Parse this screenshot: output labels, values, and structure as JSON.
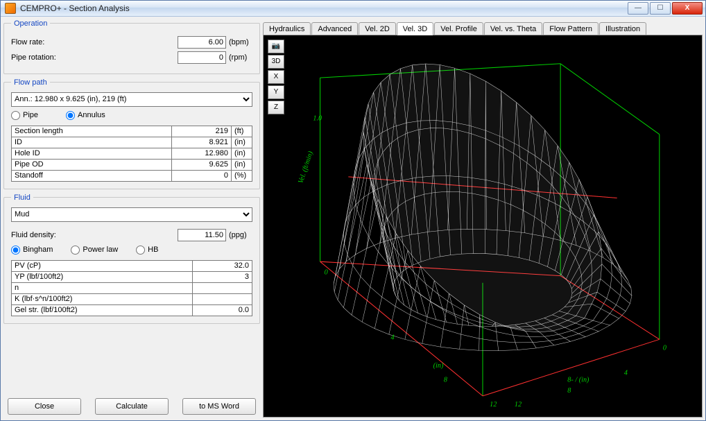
{
  "window": {
    "title": "CEMPRO+  -  Section Analysis"
  },
  "titlebar_buttons": {
    "min": "—",
    "max": "☐",
    "close": "X"
  },
  "operation": {
    "legend": "Operation",
    "flow_rate_label": "Flow rate:",
    "flow_rate_value": "6.00",
    "flow_rate_unit": "(bpm)",
    "pipe_rotation_label": "Pipe rotation:",
    "pipe_rotation_value": "0",
    "pipe_rotation_unit": "(rpm)"
  },
  "flowpath": {
    "legend": "Flow path",
    "combo_value": "Ann.: 12.980 x 9.625 (in), 219 (ft)",
    "radio_pipe": "Pipe",
    "radio_annulus": "Annulus",
    "radio_selected": "annulus",
    "rows": [
      {
        "label": "Section length",
        "value": "219",
        "unit": "(ft)"
      },
      {
        "label": "ID",
        "value": "8.921",
        "unit": "(in)"
      },
      {
        "label": "Hole ID",
        "value": "12.980",
        "unit": "(in)"
      },
      {
        "label": "Pipe OD",
        "value": "9.625",
        "unit": "(in)"
      },
      {
        "label": "Standoff",
        "value": "0",
        "unit": "(%)"
      }
    ]
  },
  "fluid": {
    "legend": "Fluid",
    "combo_value": "Mud",
    "density_label": "Fluid density:",
    "density_value": "11.50",
    "density_unit": "(ppg)",
    "radio_bingham": "Bingham",
    "radio_powerlaw": "Power law",
    "radio_hb": "HB",
    "radio_selected": "bingham",
    "rows": [
      {
        "label": "PV (cP)",
        "value": "32.0"
      },
      {
        "label": "YP (lbf/100ft2)",
        "value": "3"
      },
      {
        "label": "n",
        "value": ""
      },
      {
        "label": "K (lbf·s^n/100ft2)",
        "value": ""
      },
      {
        "label": "Gel str. (lbf/100ft2)",
        "value": "0.0"
      }
    ]
  },
  "buttons": {
    "close": "Close",
    "calculate": "Calculate",
    "msword": "to MS Word"
  },
  "tabs": [
    "Hydraulics",
    "Advanced",
    "Vel. 2D",
    "Vel. 3D",
    "Vel. Profile",
    "Vel. vs. Theta",
    "Flow Pattern",
    "Illustration"
  ],
  "active_tab_index": 3,
  "view_buttons": [
    "📷",
    "3D",
    "X",
    "Y",
    "Z"
  ],
  "chart_data": {
    "type": "surface3d",
    "title": "",
    "x_axis": {
      "label": "(in)",
      "ticks": [
        0.0,
        4.0,
        8.0,
        12.0
      ]
    },
    "y_axis": {
      "label": "8- / (in)",
      "ticks": [
        0.0,
        4.0,
        8.0,
        12.0
      ]
    },
    "z_axis": {
      "label": "Vel. (ft/min)",
      "range_shown": [
        0,
        1
      ]
    },
    "description": "3D wireframe velocity profile over an annular cross-section; surface forms a ring (annulus) with a tall lobe on one side and near-zero on the opposite side."
  }
}
